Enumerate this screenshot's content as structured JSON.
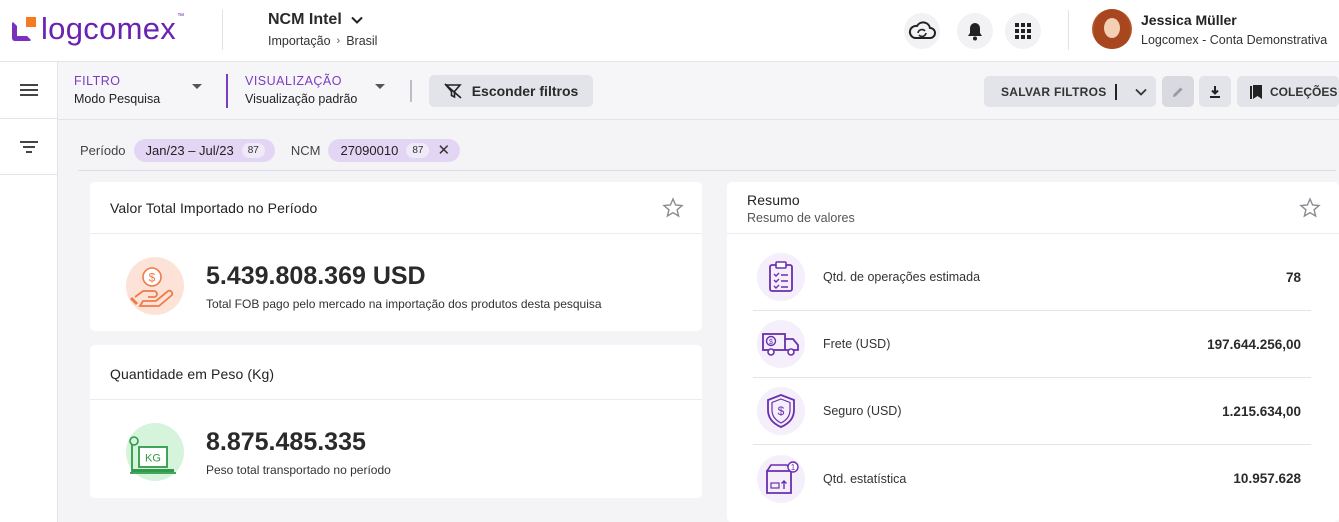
{
  "header": {
    "brand": "logcomex",
    "module_title": "NCM Intel",
    "breadcrumb": [
      "Importação",
      "Brasil"
    ],
    "icons": [
      "cloud-sync-icon",
      "bell-icon",
      "apps-grid-icon"
    ],
    "user": {
      "name": "Jessica Müller",
      "org": "Logcomex - Conta Demonstrativa"
    }
  },
  "rail": {
    "icons": [
      "hamburger-menu-icon",
      "filter-lines-icon"
    ]
  },
  "filterbar": {
    "filter_label": "FILTRO",
    "filter_value": "Modo Pesquisa",
    "view_label": "VISUALIZAÇÃO",
    "view_value": "Visualização padrão",
    "hide_filters": "Esconder filtros",
    "save_filters": "SALVAR FILTROS",
    "collections": "COLEÇÕES"
  },
  "chips": {
    "period_label": "Período",
    "period_value": "Jan/23 – Jul/23",
    "period_count": "87",
    "ncm_label": "NCM",
    "ncm_value": "27090010",
    "ncm_count": "87"
  },
  "cards": {
    "total_value": {
      "title": "Valor Total Importado no Período",
      "value": "5.439.808.369 USD",
      "desc": "Total FOB pago pelo mercado na importação dos produtos desta pesquisa"
    },
    "weight": {
      "title": "Quantidade em Peso (Kg)",
      "value": "8.875.485.335",
      "desc": "Peso total transportado no período"
    },
    "summary": {
      "title": "Resumo",
      "subtitle": "Resumo de valores",
      "rows": [
        {
          "label": "Qtd. de operações estimada",
          "value": "78",
          "icon": "clipboard-checklist-icon"
        },
        {
          "label": "Frete (USD)",
          "value": "197.644.256,00",
          "icon": "truck-dollar-icon"
        },
        {
          "label": "Seguro (USD)",
          "value": "1.215.634,00",
          "icon": "shield-dollar-icon"
        },
        {
          "label": "Qtd. estatística",
          "value": "10.957.628",
          "icon": "box-badge-icon"
        }
      ]
    }
  },
  "colors": {
    "brand_purple": "#6a22b1",
    "brand_orange": "#f47b20",
    "chip_bg": "#e3d6f5"
  }
}
